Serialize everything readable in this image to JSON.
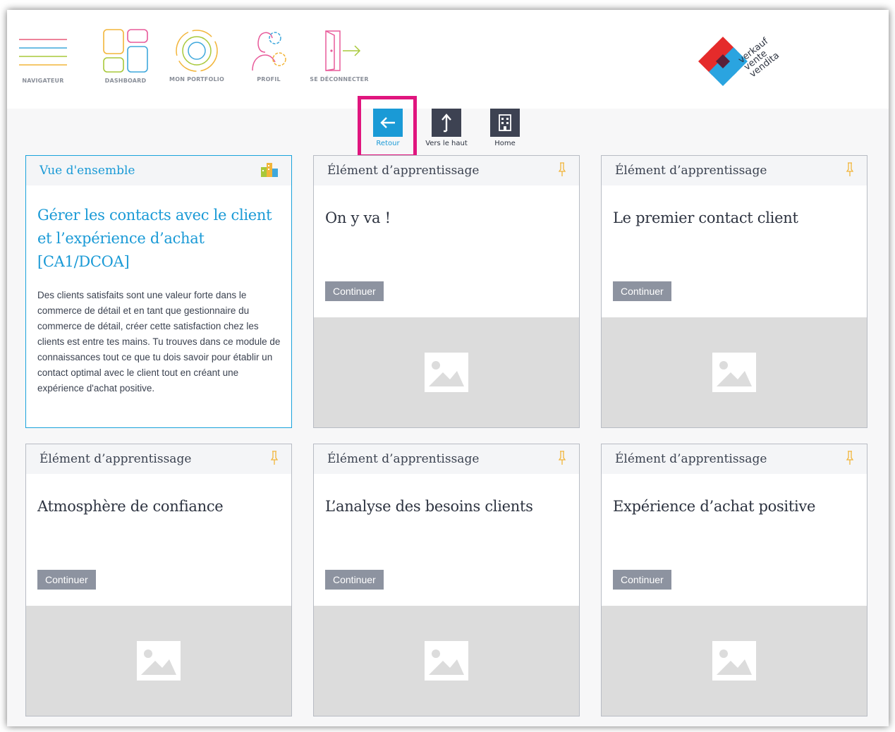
{
  "nav": {
    "items": [
      {
        "label": "NAVIGATEUR",
        "icon": "hamburger-icon"
      },
      {
        "label": "DASHBOARD",
        "icon": "dashboard-grid-icon"
      },
      {
        "label": "MON PORTFOLIO",
        "icon": "portfolio-circle-icon"
      },
      {
        "label": "PROFIL",
        "icon": "profile-gears-icon"
      },
      {
        "label": "SE DÉCONNECTER",
        "icon": "logout-door-icon"
      }
    ]
  },
  "logo": {
    "words": [
      "verkauf",
      "vente",
      "vendita"
    ],
    "colors": {
      "red": "#e52b2b",
      "blue": "#2aa4e0",
      "dark": "#5a1f3a"
    }
  },
  "actions": {
    "back_label": "Retour",
    "top_label": "Vers le haut",
    "home_label": "Home"
  },
  "overview": {
    "header": "Vue d'ensemble",
    "title": "Gérer les contacts avec le client et l’expérience d’achat [CA1/DCOA]",
    "description": "Des clients satisfaits sont une valeur forte dans le commerce de détail et en tant que gestionnaire du commerce de détail, créer cette satisfaction chez les clients est entre tes mains. Tu trouves dans ce module de connaissances tout ce que tu dois savoir pour établir un contact optimal avec le client tout en créant une expérience d'achat positive."
  },
  "cards": [
    {
      "header": "Élément d’apprentissage",
      "title": "On y va !",
      "button": "Continuer"
    },
    {
      "header": "Élément d’apprentissage",
      "title": "Le premier contact client",
      "button": "Continuer"
    },
    {
      "header": "Élément d’apprentissage",
      "title": "Atmosphère de confiance",
      "button": "Continuer"
    },
    {
      "header": "Élément d’apprentissage",
      "title": "L’analyse des besoins clients",
      "button": "Continuer"
    },
    {
      "header": "Élément d’apprentissage",
      "title": "Expérience d’achat positive",
      "button": "Continuer"
    }
  ],
  "colors": {
    "accent": "#1a9ad6",
    "highlight": "#e0157e",
    "button": "#8d93a0",
    "action_square": "#3d4252",
    "back_square": "#1a9ad6"
  }
}
